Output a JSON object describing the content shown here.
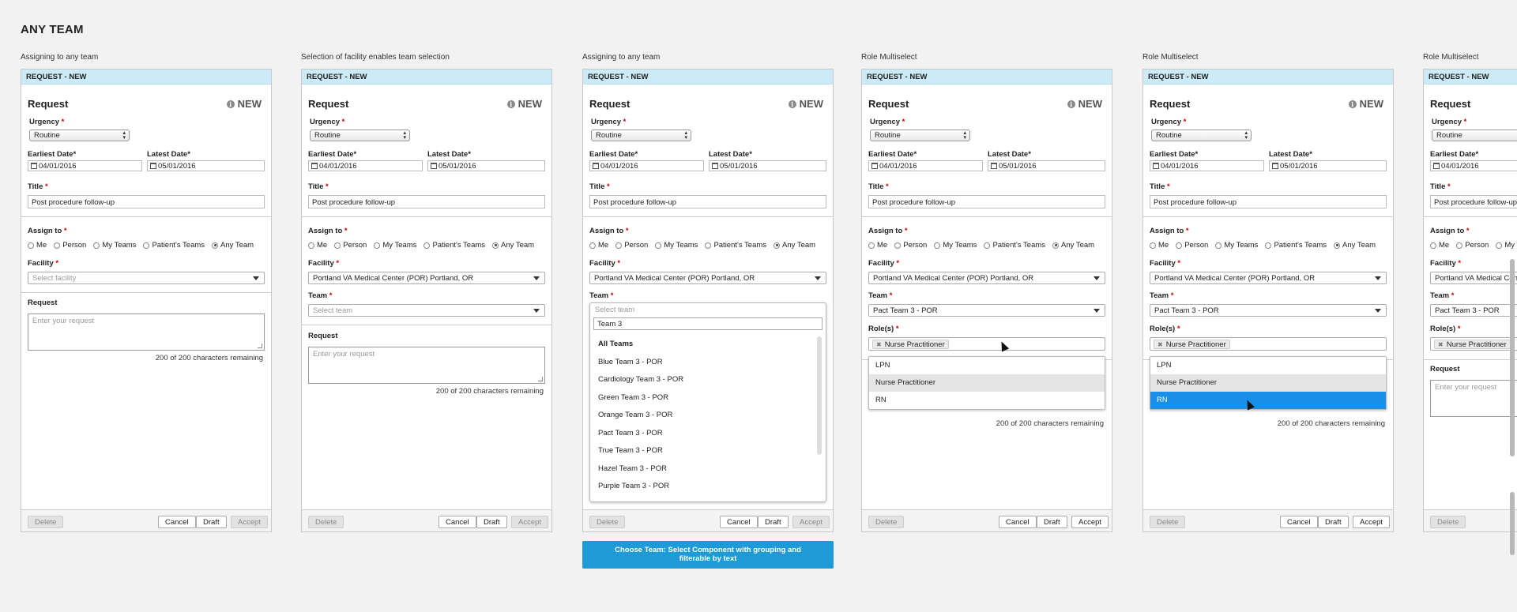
{
  "page_title": "ANY TEAM",
  "callout_text": "Choose Team: Select Component with grouping and filterable by text",
  "common": {
    "header": "REQUEST - NEW",
    "title": "Request",
    "badge": "NEW",
    "urgency_label": "Urgency",
    "urgency_value": "Routine",
    "earliest_label": "Earliest Date*",
    "earliest_value": "04/01/2016",
    "latest_label": "Latest Date*",
    "latest_value": "05/01/2016",
    "title_label": "Title",
    "title_value": "Post procedure follow-up",
    "assign_label": "Assign to",
    "assign_options": [
      "Me",
      "Person",
      "My Teams",
      "Patient's Teams",
      "Any Team"
    ],
    "facility_label": "Facility",
    "facility_placeholder": "Select facility",
    "facility_value": "Portland VA Medical Center (POR) Portland, OR",
    "team_label": "Team",
    "team_placeholder": "Select team",
    "team_value": "Pact Team 3  - POR",
    "roles_label": "Role(s)",
    "role_tag": "Nurse Practitioner",
    "request_label": "Request",
    "request_placeholder": "Enter your request",
    "chars_remaining": "200 of 200 characters remaining",
    "delete": "Delete",
    "cancel": "Cancel",
    "draft": "Draft",
    "accept": "Accept"
  },
  "panels": [
    {
      "caption": "Assigning to any team"
    },
    {
      "caption": "Selection of facility enables team selection"
    },
    {
      "caption": "Assigning to any team"
    },
    {
      "caption": "Role Multiselect"
    },
    {
      "caption": "Role Multiselect"
    },
    {
      "caption": "Role Multiselect"
    }
  ],
  "team_filter": {
    "placeholder": "Select team",
    "value": "Team 3",
    "group": "All Teams",
    "items": [
      "Blue Team 3  - POR",
      "Cardiology Team 3  - POR",
      "Green Team 3  - POR",
      "Orange Team 3  - POR",
      "Pact Team 3  - POR",
      "True Team 3  - POR",
      "Hazel Team 3  - POR",
      "Purple Team 3  - POR"
    ]
  },
  "role_options": [
    "LPN",
    "Nurse Practitioner",
    "RN"
  ],
  "colors": {
    "header_bg": "#cdeaf7",
    "selected": "#1a8fe8",
    "callout": "#1e9ad6"
  }
}
